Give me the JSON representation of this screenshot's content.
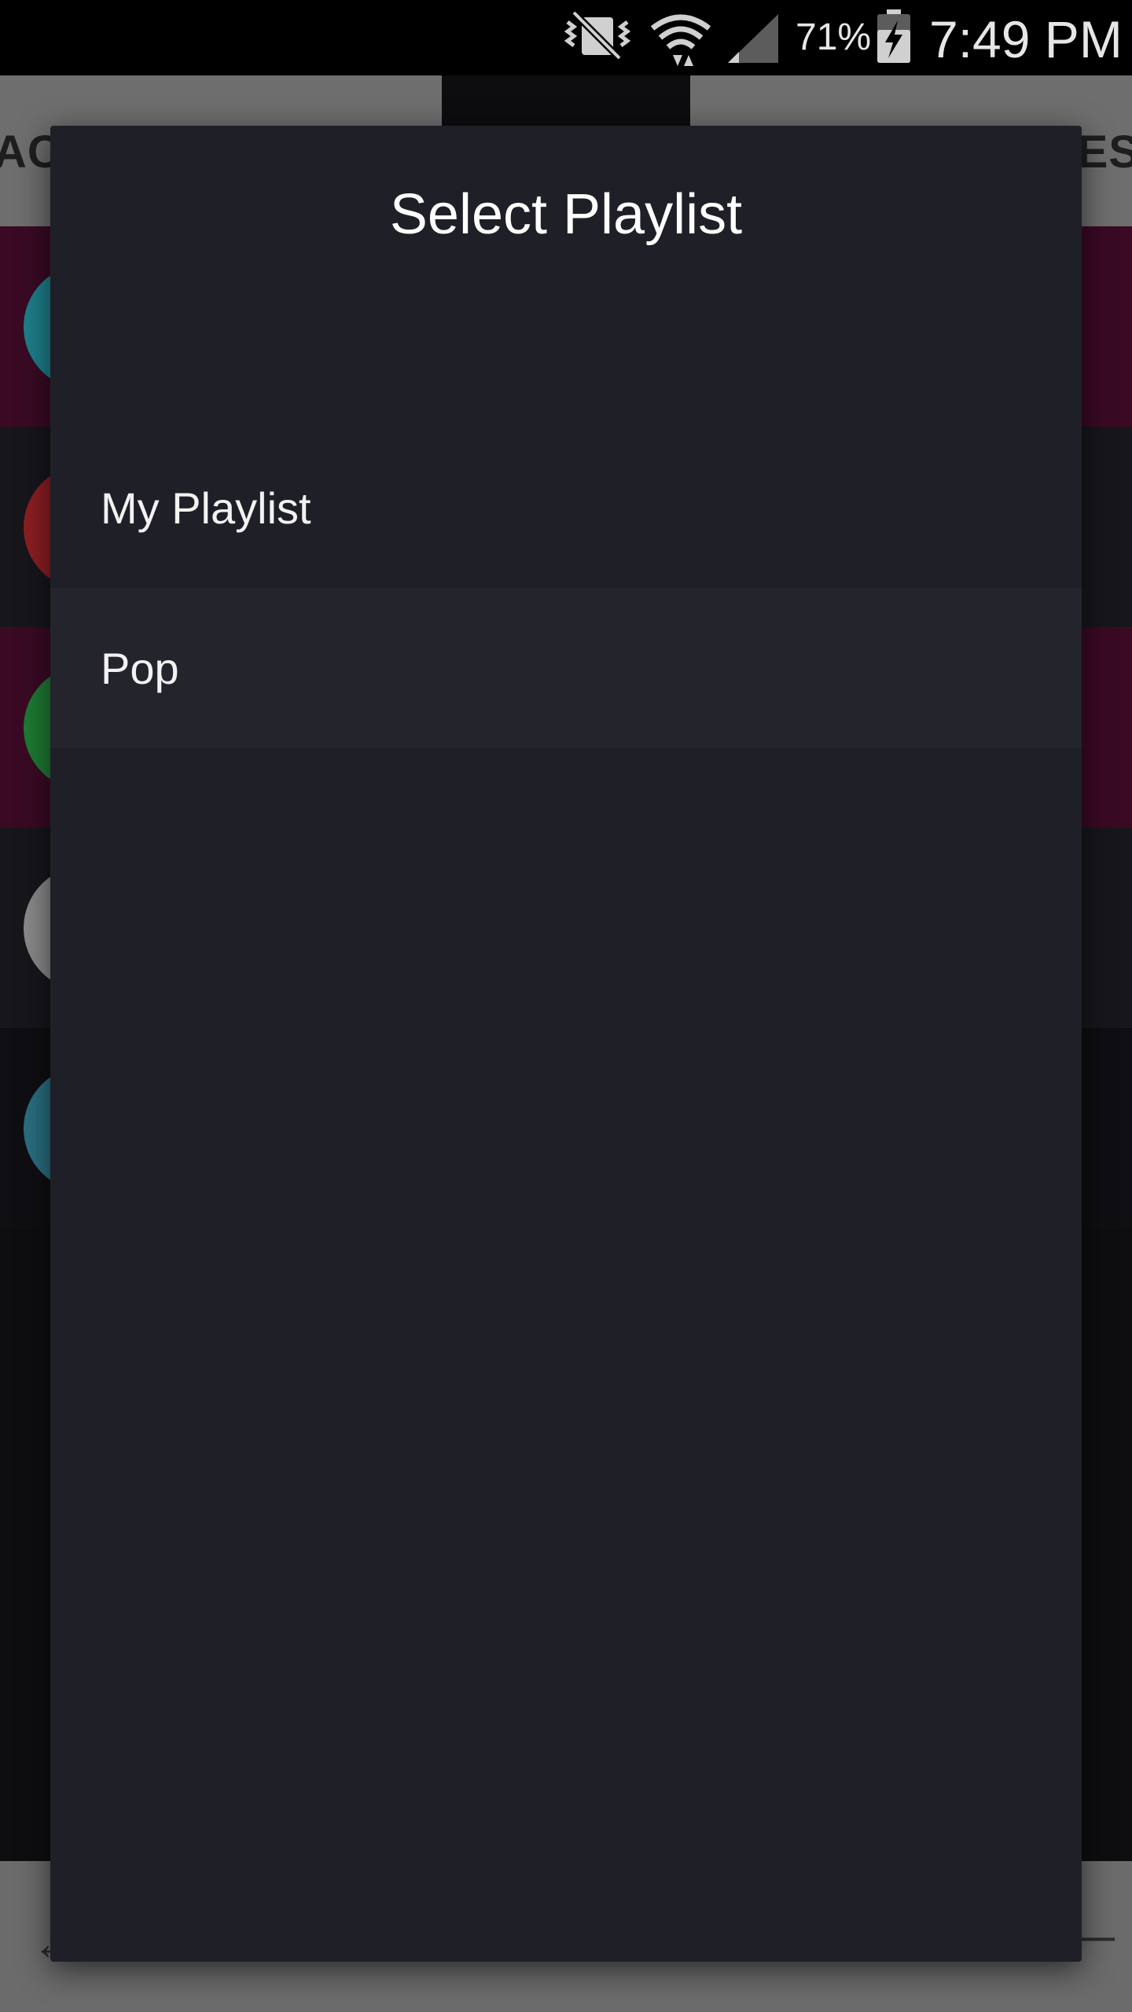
{
  "status_bar": {
    "icons": [
      "vibrate-mute-icon",
      "wifi-icon",
      "cell-signal-icon",
      "battery-charging-icon"
    ],
    "battery": "71%",
    "time": "7:49 PM"
  },
  "background": {
    "tabs": [
      {
        "label": "AC"
      },
      {
        "label": "RES"
      }
    ],
    "row_colors": [
      "#3a0a24",
      "#17161b",
      "#3a0a24",
      "#17161b",
      "#0f0e12"
    ],
    "thumb_colors": [
      "#1d7f8a",
      "#8c1e24",
      "#1e7a33",
      "#8a8a8a",
      "#2a6f80"
    ]
  },
  "dialog": {
    "title": "Select Playlist",
    "items": [
      {
        "label": "My Playlist"
      },
      {
        "label": "Pop"
      }
    ]
  },
  "colors": {
    "dialog_bg": "#1f1f27",
    "item_alt_bg": "#24242d",
    "accent_pink": "#3a0a24"
  }
}
